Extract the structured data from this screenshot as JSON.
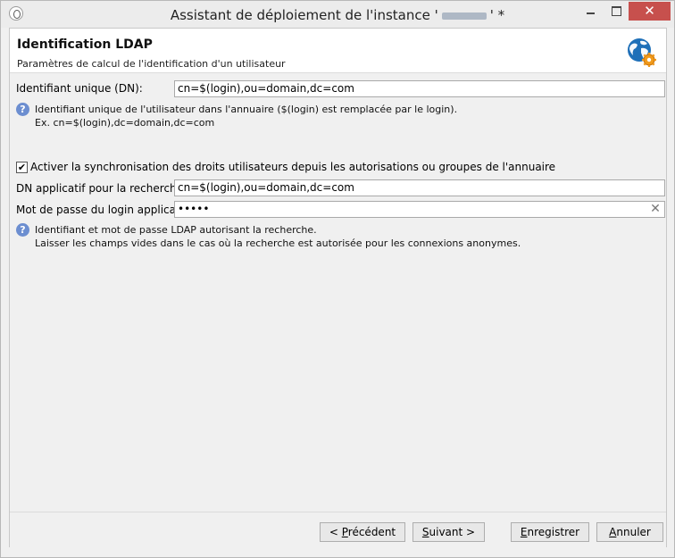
{
  "window": {
    "title_prefix": "Assistant de déploiement de l'instance '",
    "title_suffix": "' *",
    "close_glyph": "✕"
  },
  "header": {
    "title": "Identification LDAP",
    "subtitle": "Paramètres de calcul de l'identification d'un utilisateur",
    "icon": "globe-gear-icon"
  },
  "dn_section": {
    "label": "Identifiant unique (DN):",
    "value": "cn=$(login),ou=domain,dc=com",
    "help_line1": "Identifiant unique de l'utilisateur dans l'annuaire ($(login) est remplacée par le login).",
    "help_line2": "Ex. cn=$(login),dc=domain,dc=com"
  },
  "sync_section": {
    "checkbox_label": "Activer la synchronisation des droits utilisateurs depuis les autorisations ou groupes de l'annuaire",
    "checked": true,
    "check_glyph": "✔",
    "search_dn_label": "DN applicatif pour la recherche:",
    "search_dn_value": "cn=$(login),ou=domain,dc=com",
    "password_label": "Mot de passe du login applicatif:",
    "password_value": "•••••",
    "clear_glyph": "✕",
    "help_line1": "Identifiant et mot de passe LDAP autorisant la recherche.",
    "help_line2": "Laisser les champs vides dans le cas où la recherche est autorisée pour les connexions anonymes."
  },
  "help_glyph": "?",
  "footer": {
    "prev_pre": "< ",
    "prev_u": "P",
    "prev_post": "récédent",
    "next_pre": "",
    "next_u": "S",
    "next_post": "uivant >",
    "save_pre": "",
    "save_u": "E",
    "save_post": "nregistrer",
    "cancel_pre": "",
    "cancel_u": "A",
    "cancel_post": "nnuler"
  }
}
